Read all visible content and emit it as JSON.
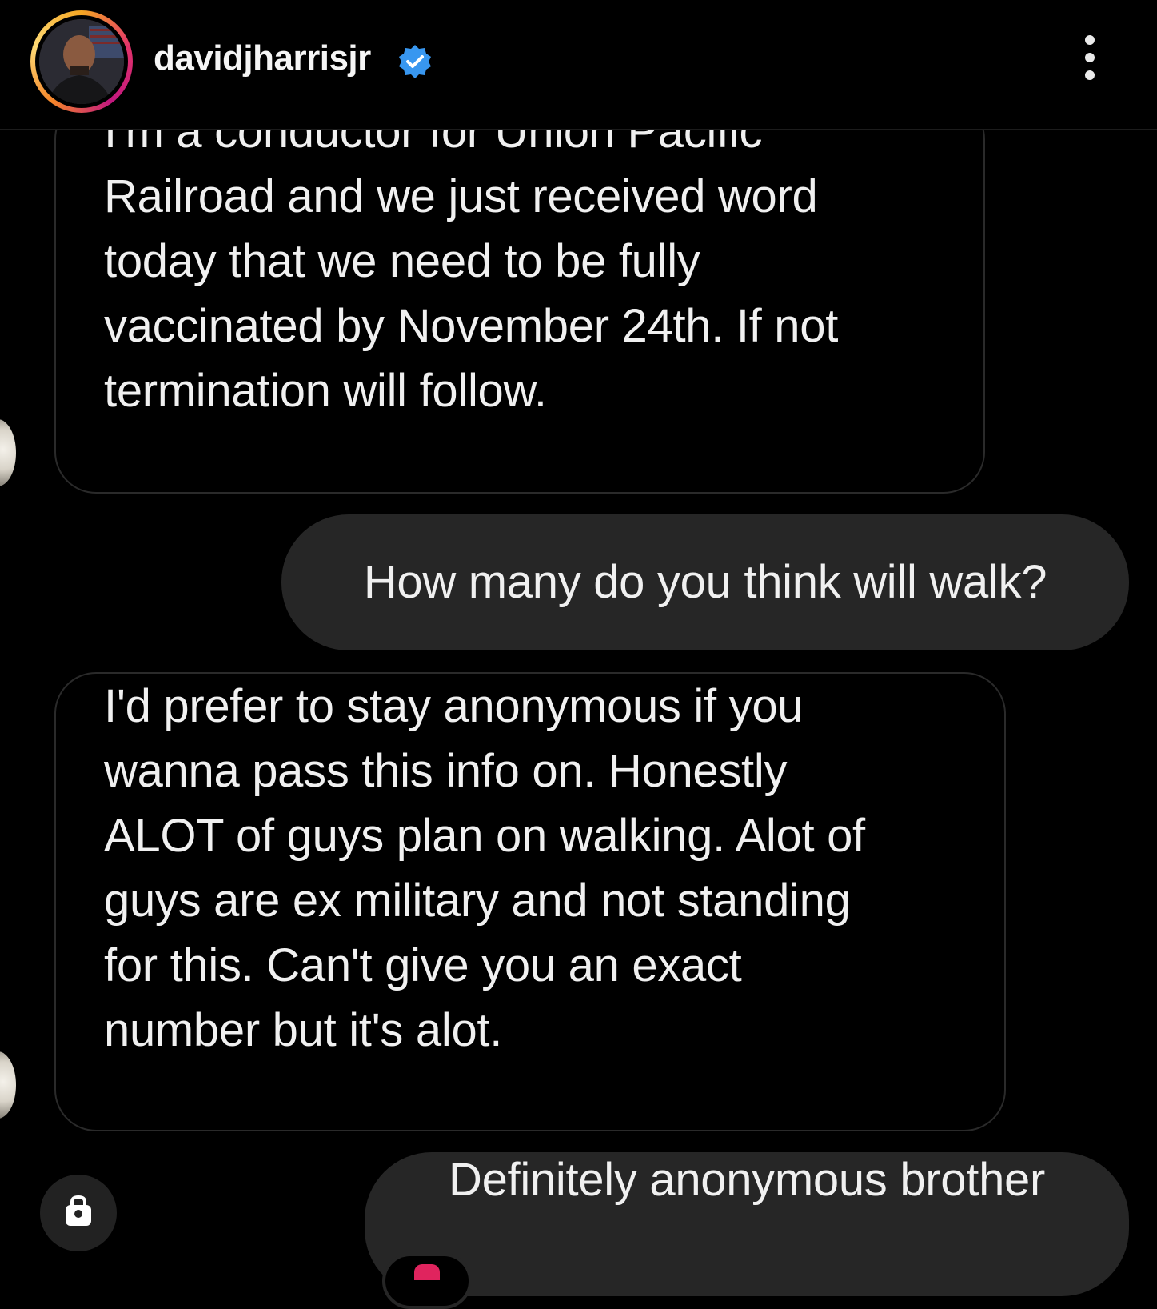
{
  "header": {
    "username": "davidjharrisjr",
    "verified_icon": "verified-badge-icon",
    "more_icon": "more-vertical-icon",
    "accent_color": "#3897f0"
  },
  "messages": [
    {
      "direction": "incoming",
      "lines": [
        "I'm a conductor for Union Pacific",
        "Railroad and we just received word",
        "today that we need to be fully",
        "vaccinated by November 24th. If not",
        "termination will follow."
      ]
    },
    {
      "direction": "outgoing",
      "lines": [
        "How many do you think will walk?"
      ]
    },
    {
      "direction": "incoming",
      "lines": [
        "I'd prefer to stay anonymous if you",
        "wanna pass this info on. Honestly",
        "ALOT of guys plan on walking. Alot of",
        "guys are ex military and not standing",
        "for this. Can't give you an exact",
        "number but it's alot."
      ]
    },
    {
      "direction": "outgoing",
      "lines": [
        "Definitely anonymous brother"
      ]
    }
  ],
  "composer": {
    "camera_icon": "camera-icon"
  },
  "reaction": {
    "icon": "heart-icon"
  }
}
